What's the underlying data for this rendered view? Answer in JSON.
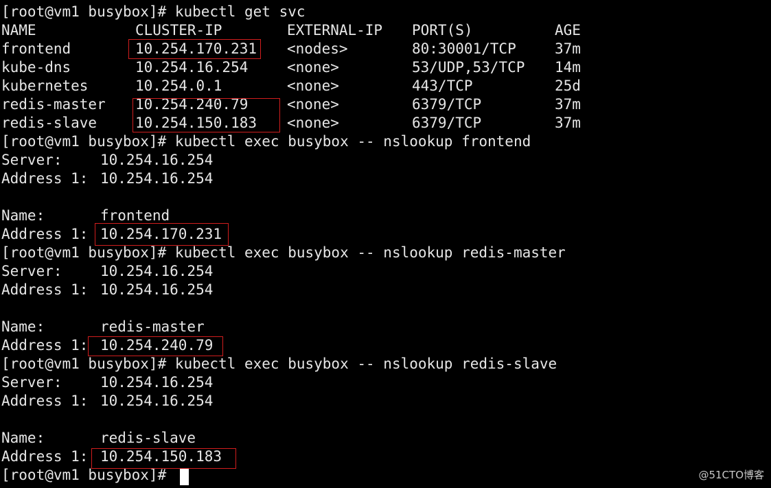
{
  "terminal": {
    "watermark": "@51CTO博客",
    "svc_command_line": "[root@vm1 busybox]# kubectl get svc",
    "svc_headers": [
      "NAME",
      "CLUSTER-IP",
      "EXTERNAL-IP",
      "PORT(S)",
      "AGE"
    ],
    "svc_rows": [
      {
        "name": "frontend",
        "cluster_ip": "10.254.170.231",
        "external_ip": "<nodes>",
        "ports": "80:30001/TCP",
        "age": "37m"
      },
      {
        "name": "kube-dns",
        "cluster_ip": "10.254.16.254",
        "external_ip": "<none>",
        "ports": "53/UDP,53/TCP",
        "age": "14m"
      },
      {
        "name": "kubernetes",
        "cluster_ip": "10.254.0.1",
        "external_ip": "<none>",
        "ports": "443/TCP",
        "age": "25d"
      },
      {
        "name": "redis-master",
        "cluster_ip": "10.254.240.79",
        "external_ip": "<none>",
        "ports": "6379/TCP",
        "age": "37m"
      },
      {
        "name": "redis-slave",
        "cluster_ip": "10.254.150.183",
        "external_ip": "<none>",
        "ports": "6379/TCP",
        "age": "37m"
      }
    ],
    "lookups": [
      {
        "command": "[root@vm1 busybox]# kubectl exec busybox -- nslookup frontend",
        "server_label": "Server:",
        "server_value": "10.254.16.254",
        "server_addr_label": "Address 1:",
        "server_addr_value": "10.254.16.254",
        "name_label": "Name:",
        "name_value": "frontend",
        "addr_label": "Address 1:",
        "addr_value": "10.254.170.231"
      },
      {
        "command": "[root@vm1 busybox]# kubectl exec busybox -- nslookup redis-master",
        "server_label": "Server:",
        "server_value": "10.254.16.254",
        "server_addr_label": "Address 1:",
        "server_addr_value": "10.254.16.254",
        "name_label": "Name:",
        "name_value": "redis-master",
        "addr_label": "Address 1:",
        "addr_value": "10.254.240.79"
      },
      {
        "command": "[root@vm1 busybox]# kubectl exec busybox -- nslookup redis-slave",
        "server_label": "Server:",
        "server_value": "10.254.16.254",
        "server_addr_label": "Address 1:",
        "server_addr_value": "10.254.16.254",
        "name_label": "Name:",
        "name_value": "redis-slave",
        "addr_label": "Address 1:",
        "addr_value": "10.254.150.183"
      }
    ],
    "final_prompt": "[root@vm1 busybox]#",
    "colors": {
      "background": "#000000",
      "text": "#e6e6e6",
      "highlight_box": "#d21e1e",
      "cursor": "#ffffff"
    }
  }
}
